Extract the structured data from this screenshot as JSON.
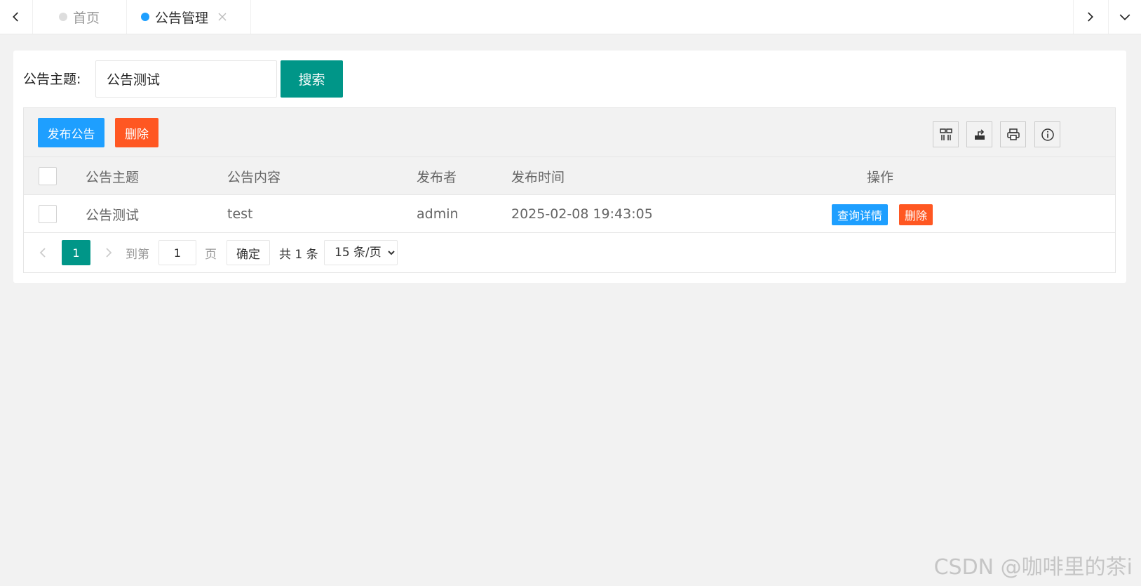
{
  "tabs": {
    "home": "首页",
    "notice": "公告管理"
  },
  "search": {
    "label": "公告主题:",
    "value": "公告测试",
    "button": "搜索"
  },
  "toolbar": {
    "publish": "发布公告",
    "delete": "删除"
  },
  "table": {
    "headers": [
      "公告主题",
      "公告内容",
      "发布者",
      "发布时间",
      "操作"
    ],
    "rows": [
      {
        "title": "公告测试",
        "content": "test",
        "publisher": "admin",
        "time": "2025-02-08 19:43:05",
        "view": "查询详情",
        "delete": "删除"
      }
    ]
  },
  "pager": {
    "current": "1",
    "goto": "到第",
    "page_input": "1",
    "page_unit": "页",
    "confirm": "确定",
    "total": "共 1 条",
    "page_size": "15 条/页",
    "page_size_options": [
      "15 条/页"
    ]
  },
  "watermark": "CSDN @咖啡里的茶i",
  "colors": {
    "primary": "#009688",
    "blue": "#1e9fff",
    "danger": "#ff5722"
  }
}
